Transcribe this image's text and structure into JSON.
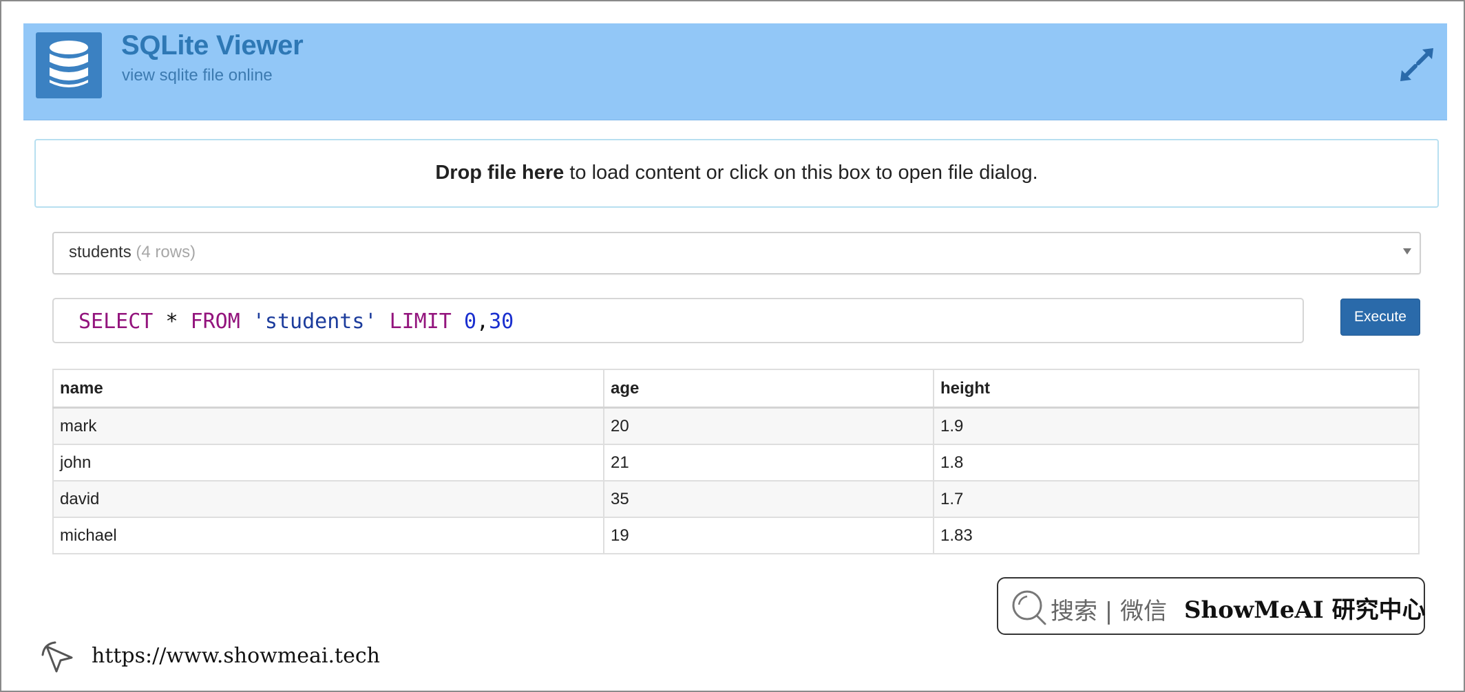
{
  "app": {
    "title": "SQLite Viewer",
    "subtitle": "view sqlite file online",
    "expand_icon": "expand-arrows-icon",
    "logo_icon": "database-icon"
  },
  "dropzone": {
    "bold_text": "Drop file here",
    "rest_text": " to load content or click on this box to open file dialog."
  },
  "table_select": {
    "selected_table": "students",
    "row_count_label": "(4 rows)"
  },
  "query": {
    "kw_select": "SELECT",
    "op_star": "*",
    "kw_from": "FROM",
    "table_literal": "'students'",
    "kw_limit": "LIMIT",
    "num_offset": "0",
    "comma": ",",
    "num_limit": "30"
  },
  "execute_button": {
    "label": "Execute"
  },
  "results": {
    "columns": [
      "name",
      "age",
      "height"
    ],
    "rows": [
      [
        "mark",
        "20",
        "1.9"
      ],
      [
        "john",
        "21",
        "1.8"
      ],
      [
        "david",
        "35",
        "1.7"
      ],
      [
        "michael",
        "19",
        "1.83"
      ]
    ]
  },
  "watermark": {
    "search_text": "搜索 | 微信",
    "brand_text": "ShowMeAI 研究中心",
    "url": "https://www.showmeai.tech"
  },
  "colors": {
    "header_bg": "#92c7f7",
    "title": "#2e78b5",
    "logo_bg": "#3b81c2",
    "execute_bg": "#2a6aaa",
    "dropzone_border": "#b7dff0"
  }
}
